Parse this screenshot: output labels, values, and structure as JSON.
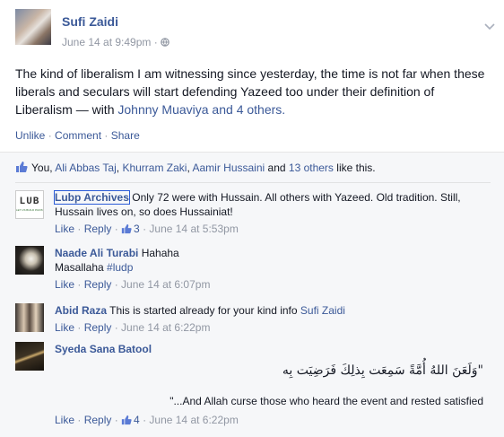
{
  "post": {
    "author": "Sufi Zaidi",
    "time": "June 14 at 9:49pm",
    "separator": "·",
    "text_main": "The kind of liberalism I am witnessing since yesterday, the time is not far when these liberals and seculars will start defending Yazeed too under their definition of Liberalism — with ",
    "tag_person": "Johnny Muaviya",
    "tag_and": " and ",
    "tag_others": "4 others",
    "tag_end": ".",
    "actions": {
      "unlike": "Unlike",
      "comment": "Comment",
      "share": "Share",
      "dot": " · "
    }
  },
  "likes": {
    "you": "You, ",
    "names": [
      "Ali Abbas Taj",
      "Khurram Zaki",
      "Aamir Hussaini"
    ],
    "comma": ", ",
    "and": " and ",
    "others": "13 others",
    "suffix": " like this."
  },
  "comments": [
    {
      "author": "Lubp Archives",
      "avatar_text": "LUB",
      "avatar_sub": "LET US BUILD PAKISTAN",
      "text": " Only 72 were with Hussain. All others with Yazeed. Old tradition. Still, Hussain lives on, so does Hussainiat!",
      "like": "Like",
      "reply": "Reply",
      "likes_count": "3",
      "time": "June 14 at 5:53pm"
    },
    {
      "author": "Naade Ali Turabi",
      "text_first": " Hahaha",
      "text_second": "Masallaha ",
      "hashtag": "#ludp",
      "like": "Like",
      "reply": "Reply",
      "time": "June 14 at 6:07pm"
    },
    {
      "author": "Abid Raza",
      "text": " This is started already for your kind info ",
      "mention": "Sufi Zaidi",
      "like": "Like",
      "reply": "Reply",
      "time": "June 14 at 6:22pm"
    },
    {
      "author": "Syeda Sana Batool",
      "arabic": "\"وَلَعَنَ اللهُ أُمَّةً سَمِعَت بِذلِكَ فَرَضِيَت بِه",
      "translation": "\"...And Allah curse those who heard the event and rested satisfied",
      "like": "Like",
      "reply": "Reply",
      "likes_count": "4",
      "time": "June 14 at 6:22pm"
    }
  ],
  "colors": {
    "link": "#3b5998",
    "meta": "#9197a3",
    "ufi_bg": "#f6f7f9"
  },
  "icons": [
    "globe-icon",
    "chevron-down-icon",
    "like-thumb-icon"
  ]
}
